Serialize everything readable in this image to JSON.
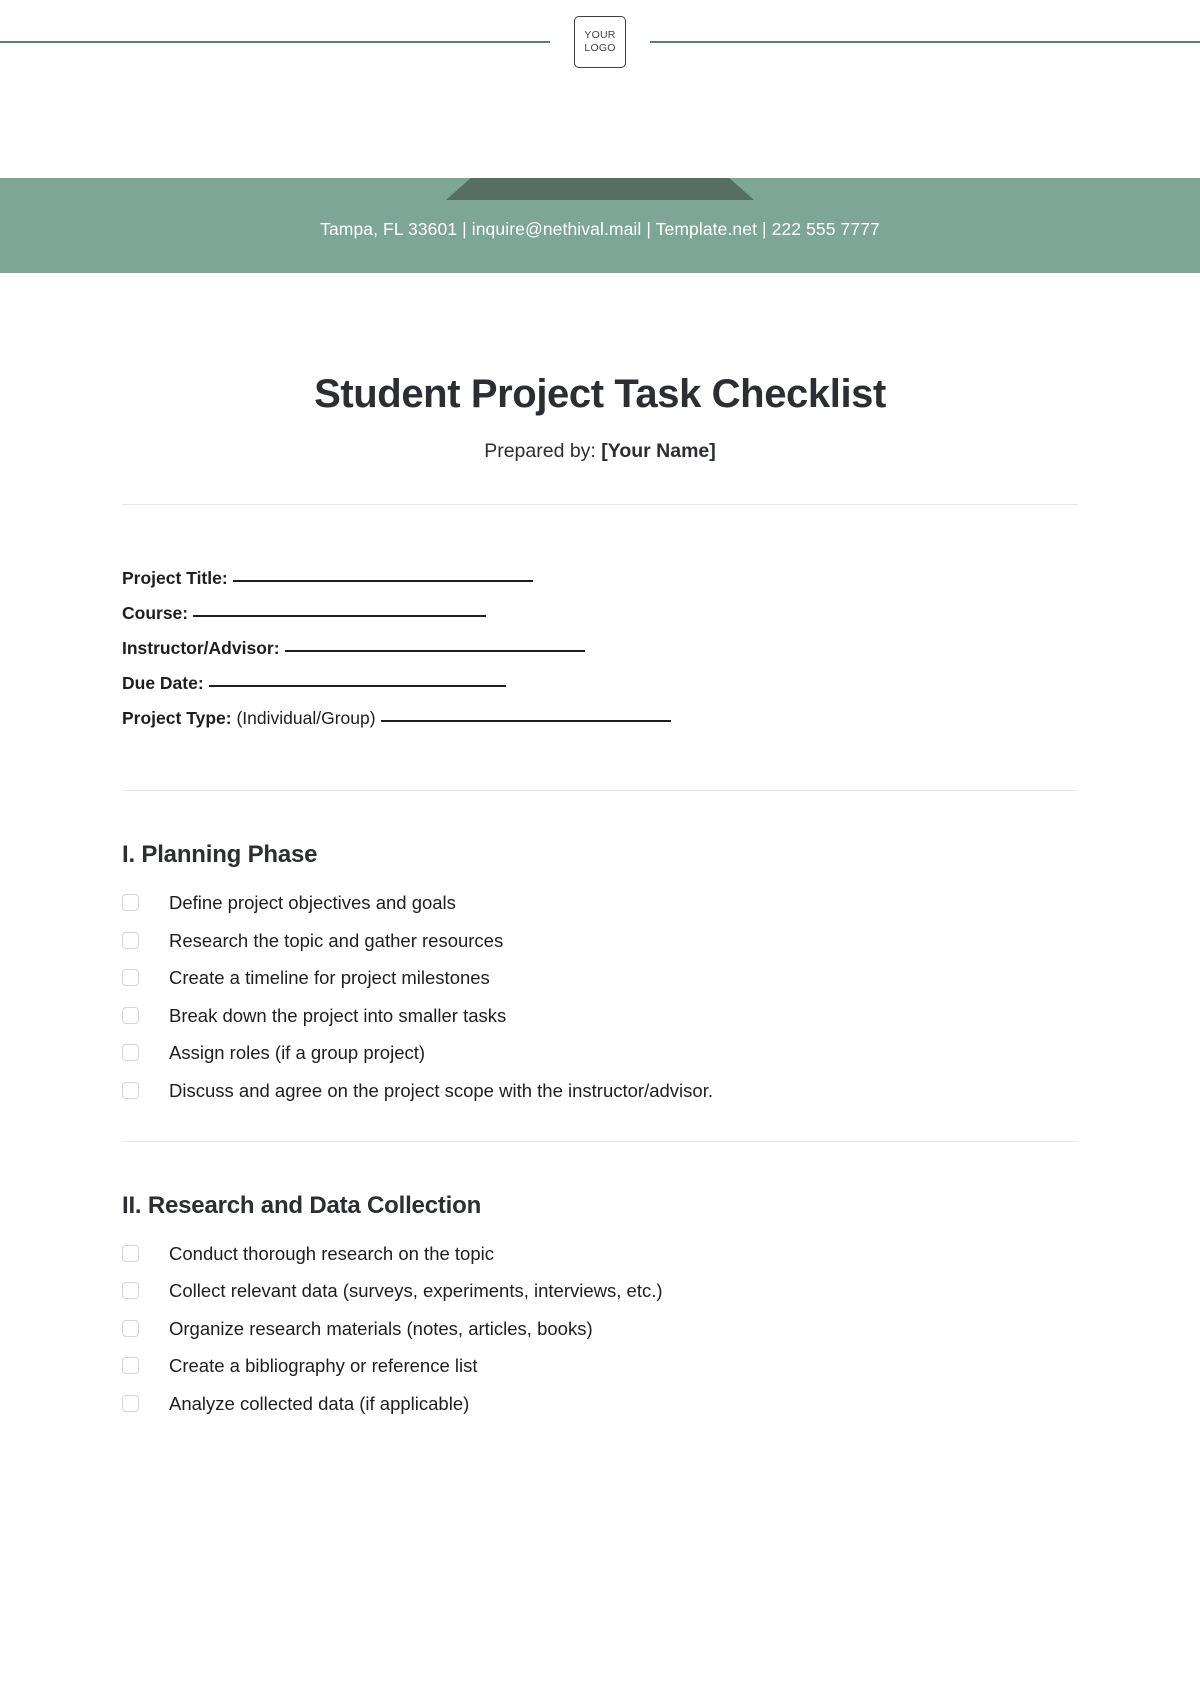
{
  "header": {
    "logo_line1": "YOUR",
    "logo_line2": "LOGO"
  },
  "banner": {
    "contact": "Tampa, FL 33601 | inquire@nethival.mail | Template.net | 222 555 7777",
    "bg_color": "#7ea696",
    "tab_color": "#566e64"
  },
  "document": {
    "title": "Student Project Task Checklist",
    "prepared_by_label": "Prepared by:",
    "prepared_by_value": "[Your Name]"
  },
  "fields": [
    {
      "label": "Project Title:",
      "note": ""
    },
    {
      "label": "Course:",
      "note": ""
    },
    {
      "label": "Instructor/Advisor:",
      "note": ""
    },
    {
      "label": "Due Date:",
      "note": ""
    },
    {
      "label": "Project Type:",
      "note": "(Individual/Group)"
    }
  ],
  "sections": [
    {
      "heading": "I. Planning Phase",
      "items": [
        "Define project objectives and goals",
        "Research the topic and gather resources",
        "Create a timeline for project milestones",
        "Break down the project into smaller tasks",
        "Assign roles (if a group project)",
        "Discuss and agree on the project scope with the instructor/advisor."
      ]
    },
    {
      "heading": "II. Research and Data Collection",
      "items": [
        "Conduct thorough research on the topic",
        "Collect relevant data (surveys, experiments, interviews, etc.)",
        "Organize research materials (notes, articles, books)",
        "Create a bibliography or reference list",
        "Analyze collected data (if applicable)"
      ]
    }
  ]
}
